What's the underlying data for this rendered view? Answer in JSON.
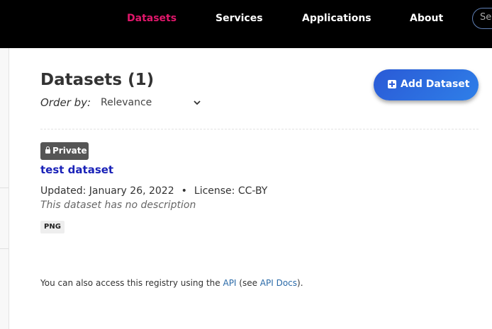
{
  "nav": {
    "items": [
      {
        "label": "Datasets",
        "active": true
      },
      {
        "label": "Services",
        "active": false
      },
      {
        "label": "Applications",
        "active": false
      },
      {
        "label": "About",
        "active": false
      }
    ],
    "search_placeholder": "Se"
  },
  "main": {
    "title": "Datasets (1)",
    "order_label": "Order by:",
    "order_value": "Relevance",
    "add_button": "Add Dataset"
  },
  "dataset": {
    "badge": "Private",
    "title": "test dataset",
    "updated": "Updated: January 26, 2022",
    "separator": "•",
    "license": "License: CC-BY",
    "description": "This dataset has no description",
    "format": "PNG"
  },
  "footer_note": {
    "prefix": "You can also access this registry using the ",
    "api_link": "API",
    "middle": " (see ",
    "docs_link": "API Docs",
    "suffix": ")."
  },
  "colors": {
    "active_nav": "#e0176b",
    "link": "#1a22b8",
    "button": "#2a5ad6"
  }
}
